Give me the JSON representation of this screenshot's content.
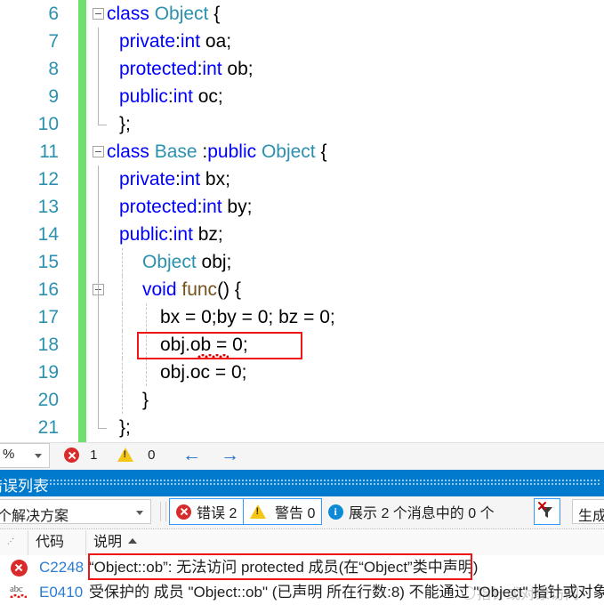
{
  "editor": {
    "lines": [
      {
        "no": "6",
        "indent": 0,
        "fold": "minus",
        "tokens": [
          {
            "t": "class ",
            "c": "kw"
          },
          {
            "t": "Object",
            "c": "typ"
          },
          {
            "t": " {",
            "c": "pl"
          }
        ]
      },
      {
        "no": "7",
        "indent": 14,
        "fold": "none",
        "tokens": [
          {
            "t": "private",
            "c": "kw"
          },
          {
            "t": ":",
            "c": "pl"
          },
          {
            "t": "int",
            "c": "kw"
          },
          {
            "t": " oa;",
            "c": "pl"
          }
        ]
      },
      {
        "no": "8",
        "indent": 14,
        "fold": "none",
        "tokens": [
          {
            "t": "protected",
            "c": "kw"
          },
          {
            "t": ":",
            "c": "pl"
          },
          {
            "t": "int",
            "c": "kw"
          },
          {
            "t": " ob;",
            "c": "pl"
          }
        ]
      },
      {
        "no": "9",
        "indent": 14,
        "fold": "none",
        "tokens": [
          {
            "t": "public",
            "c": "kw"
          },
          {
            "t": ":",
            "c": "pl"
          },
          {
            "t": "int",
            "c": "kw"
          },
          {
            "t": " oc;",
            "c": "pl"
          }
        ]
      },
      {
        "no": "10",
        "indent": 14,
        "fold": "none",
        "tokens": [
          {
            "t": "};",
            "c": "pl"
          }
        ]
      },
      {
        "no": "11",
        "indent": 0,
        "fold": "minus",
        "tokens": [
          {
            "t": "class ",
            "c": "kw"
          },
          {
            "t": "Base",
            "c": "typ"
          },
          {
            "t": " :",
            "c": "pl"
          },
          {
            "t": "public ",
            "c": "kw"
          },
          {
            "t": "Object",
            "c": "typ"
          },
          {
            "t": " {",
            "c": "pl"
          }
        ]
      },
      {
        "no": "12",
        "indent": 14,
        "fold": "none",
        "tokens": [
          {
            "t": "private",
            "c": "kw"
          },
          {
            "t": ":",
            "c": "pl"
          },
          {
            "t": "int",
            "c": "kw"
          },
          {
            "t": " bx;",
            "c": "pl"
          }
        ]
      },
      {
        "no": "13",
        "indent": 14,
        "fold": "none",
        "tokens": [
          {
            "t": "protected",
            "c": "kw"
          },
          {
            "t": ":",
            "c": "pl"
          },
          {
            "t": "int",
            "c": "kw"
          },
          {
            "t": " by;",
            "c": "pl"
          }
        ]
      },
      {
        "no": "14",
        "indent": 14,
        "fold": "none",
        "tokens": [
          {
            "t": "public",
            "c": "kw"
          },
          {
            "t": ":",
            "c": "pl"
          },
          {
            "t": "int",
            "c": "kw"
          },
          {
            "t": " bz;",
            "c": "pl"
          }
        ]
      },
      {
        "no": "15",
        "indent": 40,
        "fold": "none",
        "tokens": [
          {
            "t": "Object",
            "c": "typ"
          },
          {
            "t": " obj;",
            "c": "pl"
          }
        ]
      },
      {
        "no": "16",
        "indent": 40,
        "fold": "minus",
        "tokens": [
          {
            "t": "void ",
            "c": "kw"
          },
          {
            "t": "func",
            "c": "fn"
          },
          {
            "t": "() {",
            "c": "pl"
          }
        ]
      },
      {
        "no": "17",
        "indent": 60,
        "fold": "none",
        "tokens": [
          {
            "t": "bx = 0;by = 0; bz = 0;",
            "c": "pl"
          }
        ]
      },
      {
        "no": "18",
        "indent": 60,
        "fold": "none",
        "tokens": [
          {
            "t": "obj.ob = 0;",
            "c": "pl"
          }
        ]
      },
      {
        "no": "19",
        "indent": 60,
        "fold": "none",
        "tokens": [
          {
            "t": "obj.oc = 0;",
            "c": "pl"
          }
        ]
      },
      {
        "no": "20",
        "indent": 40,
        "fold": "none",
        "tokens": [
          {
            "t": "}",
            "c": "pl"
          }
        ]
      },
      {
        "no": "21",
        "indent": 14,
        "fold": "none",
        "tokens": [
          {
            "t": "};",
            "c": "pl"
          }
        ]
      }
    ]
  },
  "status_bar": {
    "zoom_value": "%",
    "error_count": "1",
    "warning_count": "0",
    "nav_back": "←",
    "nav_forward": "→"
  },
  "error_panel": {
    "title": "错误列表",
    "scope_filter": "个解决方案",
    "errors_button": "错误 2",
    "warnings_button": "警告 0",
    "messages_button": "展示 2 个消息中的 0 个",
    "build_filter": "生成 + Int",
    "columns": [
      {
        "label": ""
      },
      {
        "label": "代码"
      },
      {
        "label": "说明"
      }
    ],
    "rows": [
      {
        "icon": "error-icon",
        "code": "C2248",
        "description": "“Object::ob”: 无法访问 protected 成员(在“Object”类中声明)",
        "highlighted": true
      },
      {
        "icon": "intellisense-abc-icon",
        "code": "E0410",
        "description": "受保护的 成员 \"Object::ob\" (已声明 所在行数:8) 不能通过 \"Object\" 指针或对象访问",
        "highlighted": false
      }
    ]
  },
  "watermark": {
    "text": "指针或对象访问"
  },
  "colors": {
    "keyword": "#0000ff",
    "type": "#2b91af",
    "function": "#74531f",
    "line_number": "#2b91af",
    "change_bar": "#6ee06e",
    "error_box": "#f01414",
    "panel_title_bg": "#007acc",
    "accent_blue": "#2b7cd3"
  }
}
